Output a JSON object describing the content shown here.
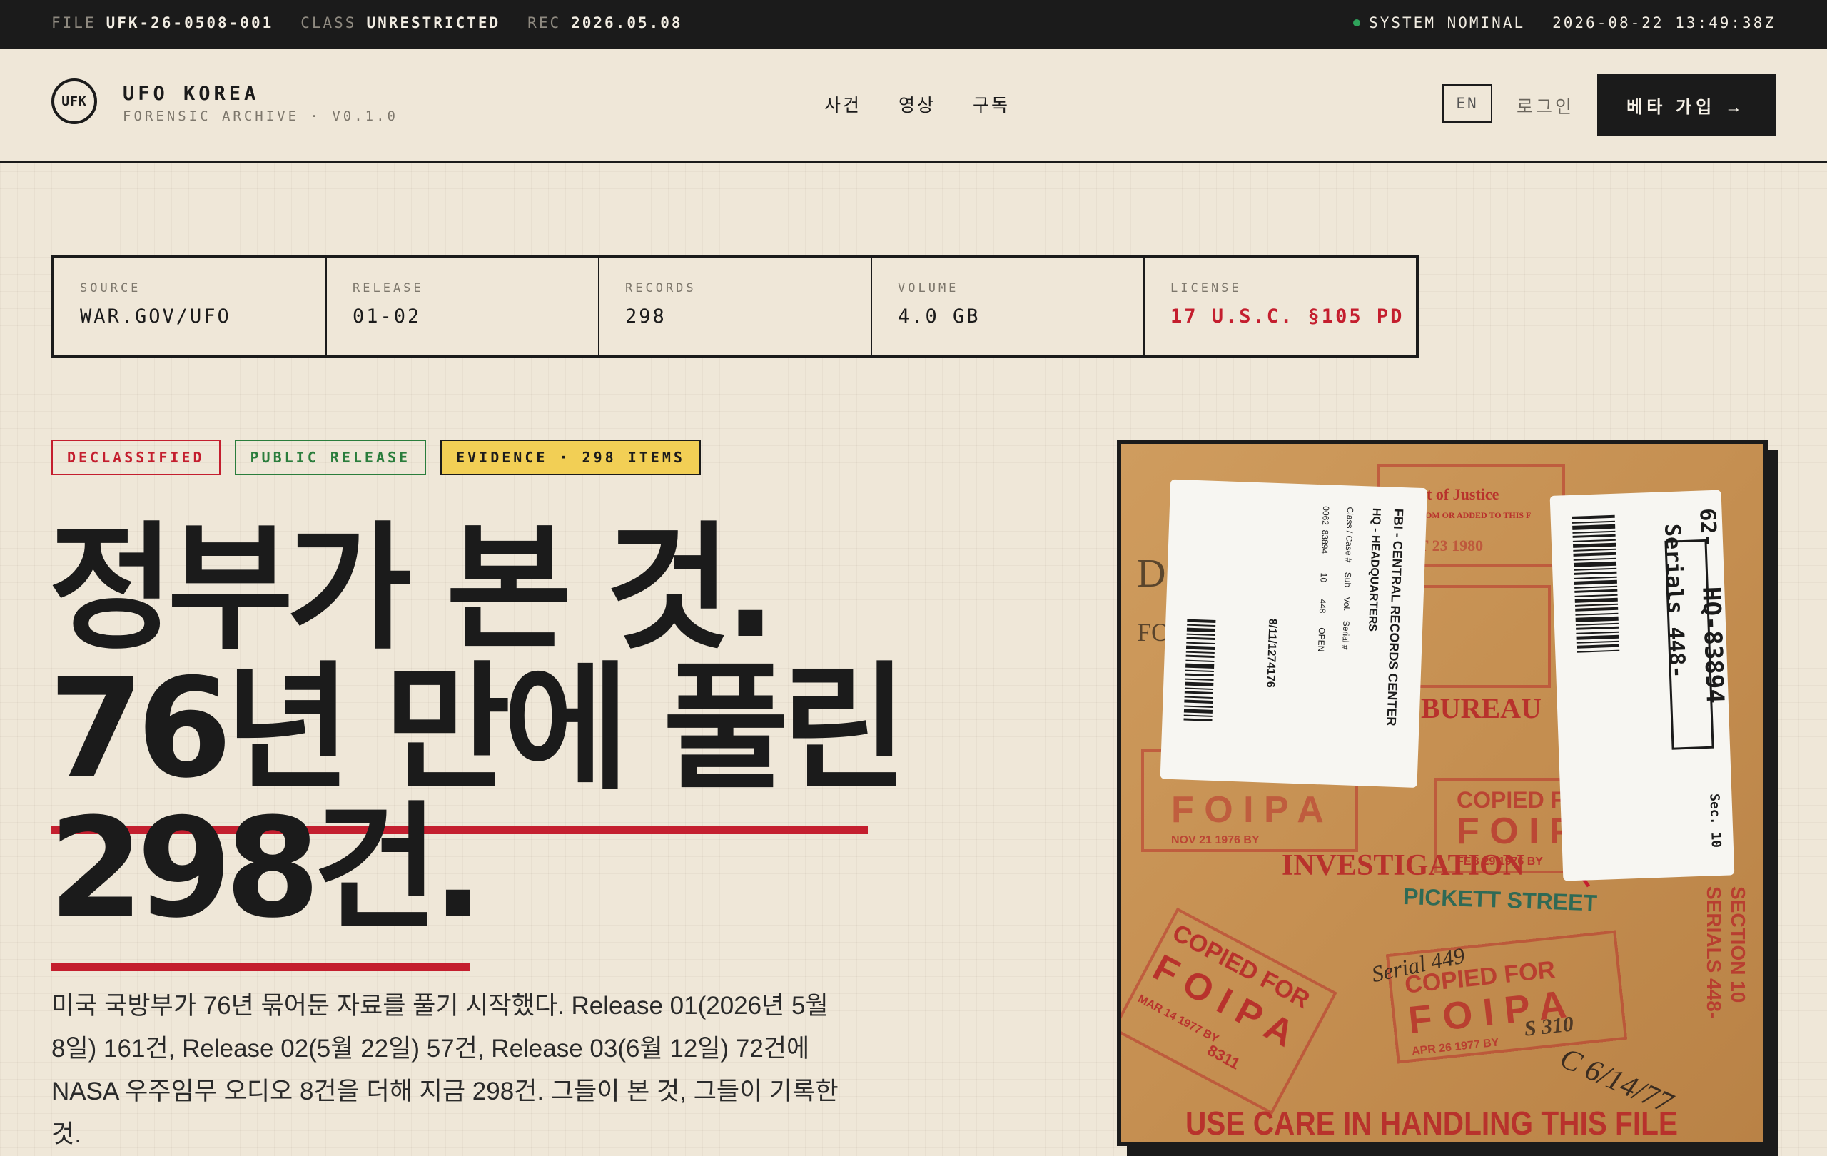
{
  "topbar": {
    "file_label": "FILE",
    "file_value": "UFK-26-0508-001",
    "class_label": "CLASS",
    "class_value": "UNRESTRICTED",
    "rec_label": "REC",
    "rec_value": "2026.05.08",
    "status": "SYSTEM NOMINAL",
    "clock": "2026-08-22 13:49:38Z",
    "status_color": "#2fa35b"
  },
  "header": {
    "logo_mark": "UFK",
    "brand_name": "UFO KOREA",
    "brand_sub": "FORENSIC ARCHIVE · V0.1.0",
    "nav": [
      "사건",
      "영상",
      "구독"
    ],
    "lang": "EN",
    "login": "로그인",
    "signup": "베타 가입 →"
  },
  "meta": [
    {
      "label": "SOURCE",
      "value": "WAR.GOV/UFO"
    },
    {
      "label": "RELEASE",
      "value": "01-02"
    },
    {
      "label": "RECORDS",
      "value": "298"
    },
    {
      "label": "VOLUME",
      "value": "4.0 GB"
    },
    {
      "label": "LICENSE",
      "value": "17 U.S.C. §105 PD"
    }
  ],
  "tags": [
    "DECLASSIFIED",
    "PUBLIC RELEASE",
    "EVIDENCE · 298 ITEMS"
  ],
  "headline": {
    "line1": "정부가 본 것.",
    "line2": "76년 만에 풀린",
    "line3": "298건."
  },
  "body": "미국 국방부가 76년 묶어둔 자료를 풀기 시작했다. Release 01(2026년 5월 8일) 161건, Release 02(5월 22일) 57건, Release 03(6월 12일) 72건에 NASA 우주임무 오디오 8건을 더해 지금 298건. 그들이 본 것, 그들이 기록한 것.",
  "document": {
    "label1_lines": [
      "FBI - CENTRAL RECORDS CENTER",
      "HQ - HEADQUARTERS",
      "Class / Case #    Sub    Vol.    Serial #",
      "0062  83894        10       448      OPEN",
      "8/11/1274176"
    ],
    "label2_lines": [
      "62-",
      "HQ-83894",
      "Serials 448-",
      "Sec. 10"
    ],
    "stamps": [
      "COPIED FOR",
      "F O I P A",
      "BUREAU",
      "INVESTIGATION",
      "PICKETT STREET",
      "COPIED FOR",
      "F O I P A",
      "SECTION 10",
      "SERIALS 448-",
      "Serial 449",
      "C 6/14/77",
      "USE CARE IN HANDLING THIS FILE",
      "t of Justice",
      "FROM OR ADDED TO THIS F",
      "NOV 21 1976 BY",
      "FEB 29 1976 BY",
      "MAR 14 1977 BY",
      "APR 26 1977 BY",
      "S 310",
      "8311",
      "CT 23 1980"
    ],
    "colors": {
      "paper": "#c99556",
      "stamp": "#b8322c",
      "label": "#f7f6f2"
    }
  },
  "colors": {
    "accent_red": "#c41e2e",
    "green": "#2a7d3c",
    "yellow": "#f2cf55",
    "ink": "#1b1b1b",
    "paper": "#efe7d8"
  }
}
